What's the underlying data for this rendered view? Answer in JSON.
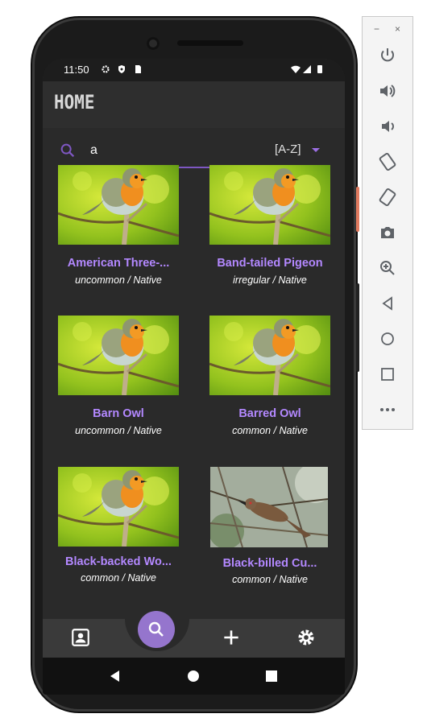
{
  "status_bar": {
    "time": "11:50"
  },
  "app_bar": {
    "title": "HOME"
  },
  "search": {
    "value": "a",
    "sort_label": "[A-Z]"
  },
  "birds": [
    {
      "name": "American Three-...",
      "status": "uncommon / Native",
      "photo": "robin"
    },
    {
      "name": "Band-tailed Pigeon",
      "status": "irregular / Native",
      "photo": "robin"
    },
    {
      "name": "Barn Owl",
      "status": "uncommon / Native",
      "photo": "robin"
    },
    {
      "name": "Barred Owl",
      "status": "common / Native",
      "photo": "robin"
    },
    {
      "name": "Black-backed Wo...",
      "status": "common / Native",
      "photo": "robin"
    },
    {
      "name": "Black-billed Cu...",
      "status": "common / Native",
      "photo": "cuckoo"
    }
  ],
  "bottom_nav": {
    "items": [
      "contact-icon",
      "search-icon",
      "add-icon",
      "settings-icon"
    ],
    "active": "search-icon",
    "accent": "#9575cd"
  },
  "colors": {
    "accent": "#7e57c2",
    "name_text": "#b388ff",
    "background": "#2a2a2a"
  },
  "emulator_toolbar": {
    "window_controls": [
      "−",
      "×"
    ],
    "tools": [
      "power-icon",
      "volume-up-icon",
      "volume-down-icon",
      "rotate-left-icon",
      "rotate-right-icon",
      "screenshot-icon",
      "zoom-icon",
      "back-icon",
      "home-icon",
      "overview-icon",
      "more-icon"
    ]
  }
}
